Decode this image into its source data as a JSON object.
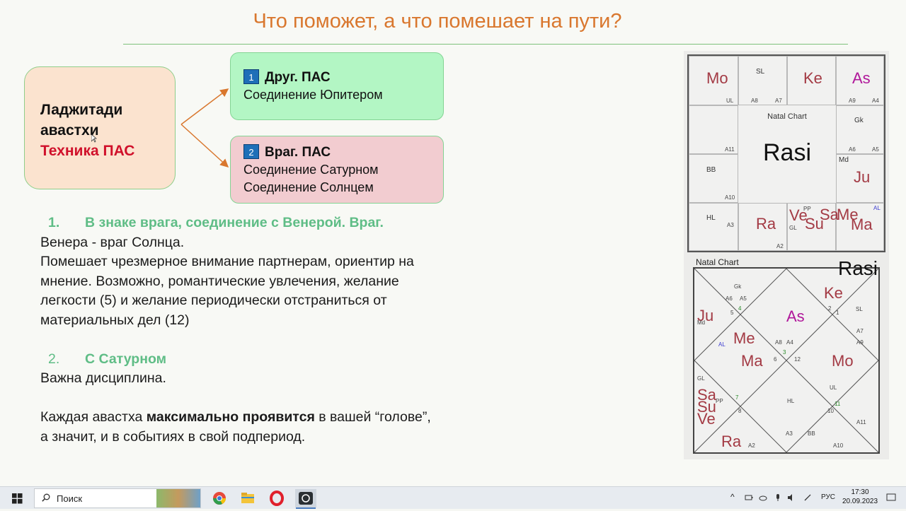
{
  "slide": {
    "title": "Что поможет, а что помешает на пути?",
    "lag_box": {
      "line1": "Ладжитади",
      "line2": "авастхи",
      "line3": "Техника ПАС"
    },
    "friend_box": {
      "badge": "1",
      "title": "Друг. ПАС",
      "line1": "Соединение Юпитером"
    },
    "enemy_box": {
      "badge": "2",
      "title": "Враг. ПАС",
      "line1": "Соединение Сатурном",
      "line2": "Соединение Солнцем"
    },
    "item1": {
      "num": "1.",
      "head": "В знаке врага, соединение с Венерой. Враг."
    },
    "para1": [
      "Венера - враг Солнца.",
      "Помешает чрезмерное внимание партнерам, ориентир на",
      "мнение. Возможно, романтические увлечения, желание",
      "легкости (5) и желание периодически отстраниться от",
      "материальных дел (12)"
    ],
    "item2": {
      "num": "2.",
      "head": "С Сатурном"
    },
    "para2": "Важна дисциплина.",
    "closing": {
      "pre": "Каждая авастха ",
      "bold": "максимально проявится",
      "post": " в вашей “голове”,",
      "line2": "а значит, и в событиях в  свой подпериод."
    }
  },
  "rasi_chart": {
    "center_caption": "Natal Chart",
    "center_title": "Rasi",
    "cells": {
      "c00": {
        "planet": "Mo",
        "sub": "UL"
      },
      "c01": {
        "top": "SL",
        "sub1": "A8",
        "sub2": "A7"
      },
      "c02": {
        "planet": "Ke"
      },
      "c03": {
        "planet": "As",
        "sub1": "A9",
        "sub2": "A4"
      },
      "c10": {
        "sub": "A11"
      },
      "c13": {
        "top": "Gk",
        "sub1": "A6",
        "sub2": "A5"
      },
      "c20": {
        "top": "BB",
        "sub": "A10"
      },
      "c23": {
        "top": "Md",
        "planet": "Ju"
      },
      "c30": {
        "top": "HL",
        "sub": "A3"
      },
      "c31": {
        "planet": "Ra",
        "sub": "A2"
      },
      "c32": {
        "p1": "Ve",
        "p2": "Su",
        "pp": "PP",
        "gl": "GL"
      },
      "c33": {
        "p1": "Sa",
        "p2": "Me",
        "p3": "Ma",
        "al": "AL"
      }
    }
  },
  "north_chart": {
    "caption": "Natal Chart",
    "title": "Rasi",
    "labels": {
      "gk": "Gk",
      "a6": "A6",
      "a5": "A5",
      "n5": "5",
      "n4": "4",
      "ke": "Ke",
      "n2": "2",
      "n1": "1",
      "sl": "SL",
      "ju": "Ju",
      "md": "Md",
      "as": "As",
      "a7": "A7",
      "a9": "A9",
      "al": "AL",
      "me": "Me",
      "ma": "Ma",
      "a8": "A8",
      "a4": "A4",
      "n3": "3",
      "n6": "6",
      "n12": "12",
      "mo": "Mo",
      "ul": "UL",
      "gl": "GL",
      "sa": "Sa",
      "su": "Su",
      "ve": "Ve",
      "pp": "PP",
      "n7": "7",
      "n8": "8",
      "hl": "HL",
      "n10": "10",
      "n11": "11",
      "a11": "A11",
      "ra": "Ra",
      "a2": "A2",
      "a3": "A3",
      "bb": "BB",
      "a10": "A10"
    }
  },
  "taskbar": {
    "search_placeholder": "Поиск",
    "lang": "РУС",
    "time": "17:30",
    "date": "20.09.2023"
  },
  "colors": {
    "title": "#d9772e",
    "accent_green": "#5fbd86",
    "accent_red": "#d0112b",
    "planet": "#a33a44"
  }
}
